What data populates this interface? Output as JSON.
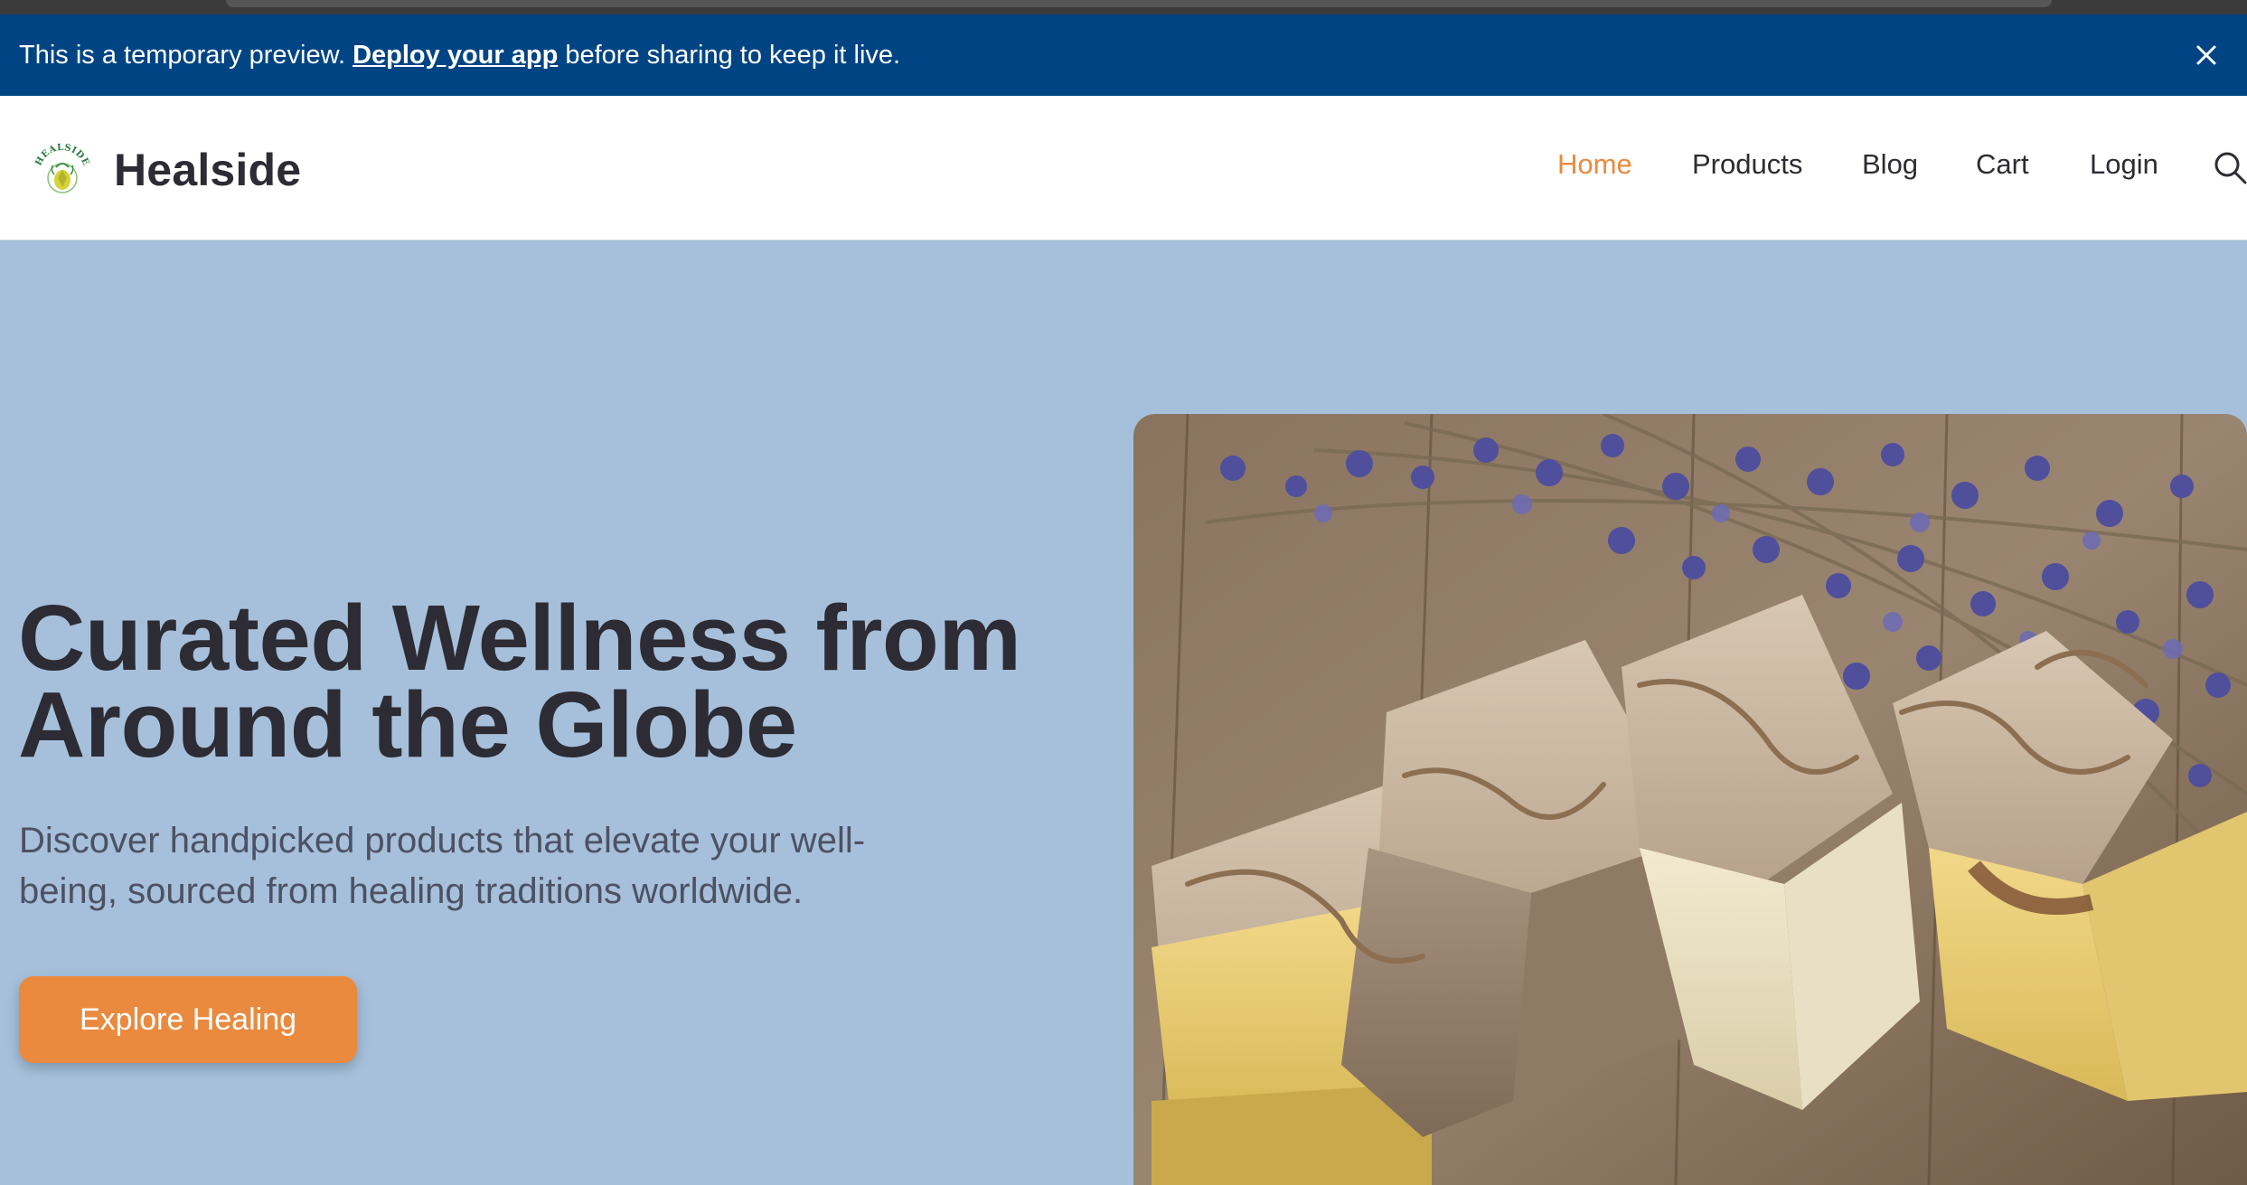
{
  "colors": {
    "banner_bg": "#004484",
    "hero_bg": "#a6c0dc",
    "accent": "#ea8a3f",
    "text_dark": "#2d2b33",
    "text_muted": "#4d5162"
  },
  "banner": {
    "text_before": "This is a temporary preview.",
    "link": "Deploy your app",
    "text_after": "before sharing to keep it live.",
    "close_icon": "close-icon"
  },
  "brand": {
    "name": "Healside",
    "logo_text": "HEALSIDE"
  },
  "nav": {
    "items": [
      {
        "label": "Home",
        "active": true
      },
      {
        "label": "Products",
        "active": false
      },
      {
        "label": "Blog",
        "active": false
      },
      {
        "label": "Cart",
        "active": false
      },
      {
        "label": "Login",
        "active": false
      }
    ],
    "search_icon": "search-icon"
  },
  "hero": {
    "title_line1": "Curated Wellness from",
    "title_line2": "Around the Globe",
    "subtitle_line1": "Discover handpicked products that elevate your well-",
    "subtitle_line2": "being, sourced from healing traditions worldwide.",
    "cta": "Explore Healing",
    "image": "lavender-soap-bars-image"
  }
}
